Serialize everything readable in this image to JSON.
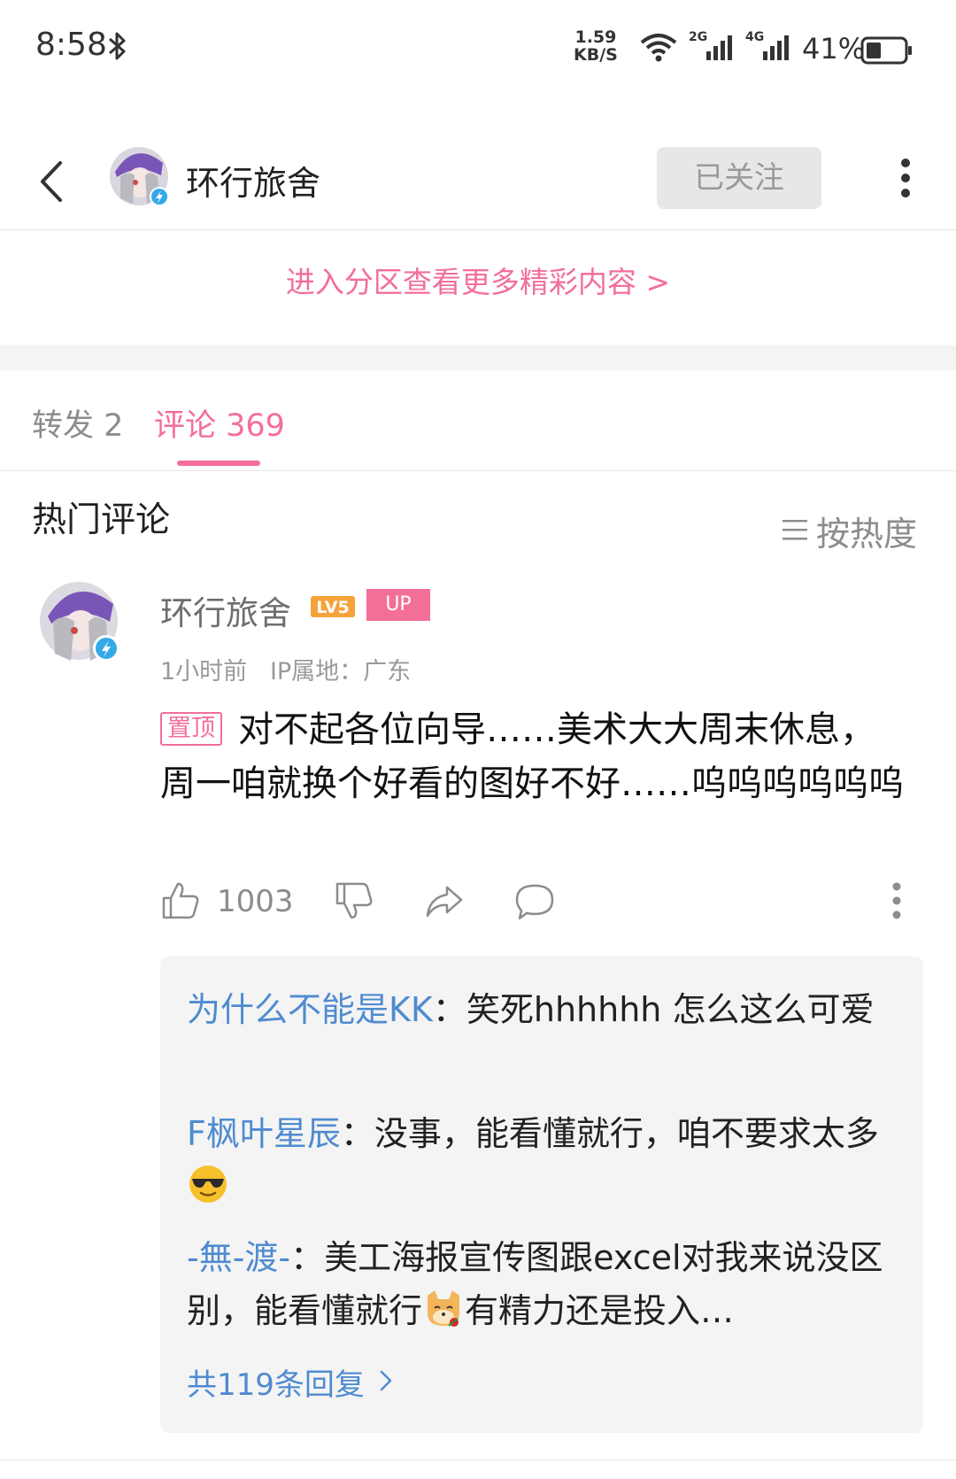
{
  "status_bar": {
    "time": "8:58",
    "net_speed_value": "1.59",
    "net_speed_unit": "KB/S",
    "sim1_label": "2G",
    "sim2_label": "4G",
    "battery": "41%",
    "battery_level": 0.41
  },
  "header": {
    "title": "环行旅舍",
    "follow_label": "已关注"
  },
  "enter_section": "进入分区查看更多精彩内容 >",
  "tabs": [
    {
      "label": "转发 2"
    },
    {
      "label": "评论 369"
    }
  ],
  "hot_comments": {
    "title": "热门评论",
    "sort_label": "按热度"
  },
  "comment": {
    "username": "环行旅舍",
    "level": "LV5",
    "up_badge": "UP",
    "time": "1小时前",
    "ip": "IP属地：广东",
    "pin_label": "置顶",
    "text": "对不起各位向导……美术大大周末休息，周一咱就换个好看的图好不好……呜呜呜呜呜呜",
    "likes": "1003",
    "replies": [
      {
        "user": "为什么不能是KK",
        "sep": "：",
        "text": "笑死hhhhhh 怎么这么可爱"
      },
      {
        "user": "F枫叶星辰",
        "sep": "：",
        "text": "没事，能看懂就行，咱不要求太多",
        "emoji": "sunglasses-emoji"
      },
      {
        "user": "-無-渡-",
        "sep": "：",
        "text_a": "美工海报宣传图跟excel对我来说没区别，能看懂就行",
        "emoji": "dog-rose-emoji",
        "text_b": "有精力还是投入…"
      }
    ],
    "all_replies": "共119条回复"
  },
  "colors": {
    "pink": "#f36f98",
    "blue_link": "#4f8bd0",
    "gray_text": "#8c8c8c"
  }
}
